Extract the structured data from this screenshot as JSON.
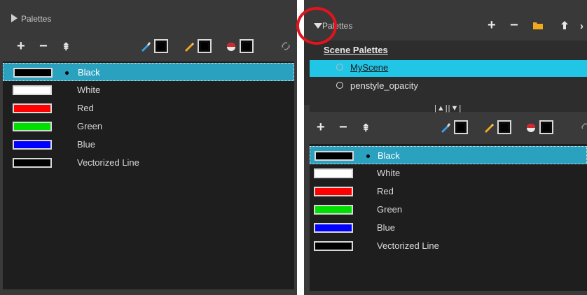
{
  "left": {
    "title": "Palettes",
    "toolbar": {
      "add": "+",
      "remove": "−",
      "merge": "⇞"
    },
    "colors": [
      {
        "name": "Black",
        "swatch": "#000000",
        "selected": true
      },
      {
        "name": "White",
        "swatch": "#ffffff",
        "selected": false
      },
      {
        "name": "Red",
        "swatch": "#ff0000",
        "selected": false
      },
      {
        "name": "Green",
        "swatch": "#00e000",
        "selected": false
      },
      {
        "name": "Blue",
        "swatch": "#0000ff",
        "selected": false
      },
      {
        "name": "Vectorized Line",
        "swatch": "#000000",
        "selected": false
      }
    ]
  },
  "right": {
    "title": "Palettes",
    "header_toolbar": {
      "add": "+",
      "remove": "−",
      "folder_icon": "folder-icon",
      "up_icon": "arrow-up-icon"
    },
    "scene_palettes_header": "Scene Palettes",
    "scene_palettes": [
      {
        "name": "MyScene",
        "selected": true
      },
      {
        "name": "penstyle_opacity",
        "selected": false
      }
    ],
    "splitter": "|▲||▼|",
    "toolbar": {
      "add": "+",
      "remove": "−",
      "merge": "⇞"
    },
    "colors": [
      {
        "name": "Black",
        "swatch": "#000000",
        "selected": true
      },
      {
        "name": "White",
        "swatch": "#ffffff",
        "selected": false
      },
      {
        "name": "Red",
        "swatch": "#ff0000",
        "selected": false
      },
      {
        "name": "Green",
        "swatch": "#00e000",
        "selected": false
      },
      {
        "name": "Blue",
        "swatch": "#0000ff",
        "selected": false
      },
      {
        "name": "Vectorized Line",
        "swatch": "#000000",
        "selected": false
      }
    ]
  },
  "colors": {
    "selection": "#2ba1c0",
    "scene_selection": "#21c5e6",
    "highlight_circle": "#e0141e"
  }
}
